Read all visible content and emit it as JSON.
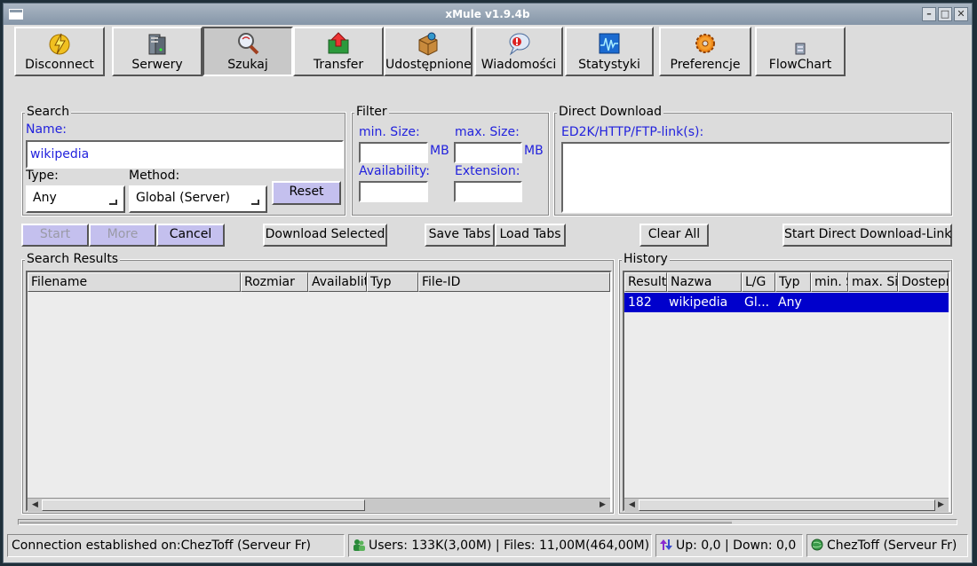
{
  "window": {
    "title": "xMule v1.9.4b"
  },
  "toolbar": {
    "buttons": [
      {
        "label": "Disconnect"
      },
      {
        "label": "Serwery"
      },
      {
        "label": "Szukaj"
      },
      {
        "label": "Transfer"
      },
      {
        "label": "Udostępnione"
      },
      {
        "label": "Wiadomości"
      },
      {
        "label": "Statystyki"
      },
      {
        "label": "Preferencje"
      },
      {
        "label": "FlowChart"
      }
    ]
  },
  "search": {
    "group_title": "Search",
    "name_label": "Name:",
    "name_value": "wikipedia",
    "type_label": "Type:",
    "type_value": "Any",
    "method_label": "Method:",
    "method_value": "Global (Server)",
    "reset_label": "Reset"
  },
  "filter": {
    "group_title": "Filter",
    "min_size_label": "min. Size:",
    "max_size_label": "max. Size:",
    "unit": "MB",
    "availability_label": "Availability:",
    "extension_label": "Extension:"
  },
  "direct": {
    "group_title": "Direct Download",
    "link_label": "ED2K/HTTP/FTP-link(s):"
  },
  "actions": {
    "start": "Start",
    "more": "More",
    "cancel": "Cancel",
    "download_selected": "Download Selected",
    "save_tabs": "Save Tabs",
    "load_tabs": "Load Tabs",
    "clear_all": "Clear All",
    "start_direct": "Start Direct Download-Link"
  },
  "results": {
    "group_title": "Search Results",
    "columns": [
      "Filename",
      "Rozmiar",
      "Availablity",
      "Typ",
      "File-ID"
    ]
  },
  "history": {
    "group_title": "History",
    "columns": [
      "Results",
      "Nazwa",
      "L/G",
      "Typ",
      "min. Size",
      "max. Size",
      "Dostepność"
    ],
    "rows": [
      {
        "results": "182",
        "name": "wikipedia",
        "lg": "Gl...",
        "type": "Any"
      }
    ]
  },
  "status": {
    "connection": "Connection established on:ChezToff (Serveur Fr)",
    "users_files": "Users: 133K(3,00M) | Files: 11,00M(464,00M)",
    "transfer": "Up: 0,0 | Down: 0,0",
    "server": "ChezToff (Serveur Fr)"
  },
  "colors": {
    "accent_blue": "#2222dd",
    "selection": "#0000cc",
    "button_purple": "#c4c0ee"
  }
}
